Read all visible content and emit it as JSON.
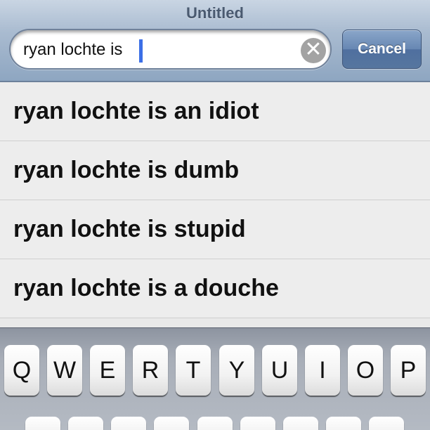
{
  "window": {
    "title": "Untitled"
  },
  "search": {
    "query": "ryan lochte is",
    "clear_glyph": "✕",
    "cancel_label": "Cancel"
  },
  "suggestions": [
    "ryan lochte is an idiot",
    "ryan lochte is dumb",
    "ryan lochte is stupid",
    "ryan lochte is a douche"
  ],
  "keyboard": {
    "row1": [
      "Q",
      "W",
      "E",
      "R",
      "T",
      "Y",
      "U",
      "I",
      "O",
      "P"
    ]
  },
  "colors": {
    "caret": "#3c6fe6",
    "bar": "#a9bbd0",
    "cancel": "#6787b3"
  }
}
